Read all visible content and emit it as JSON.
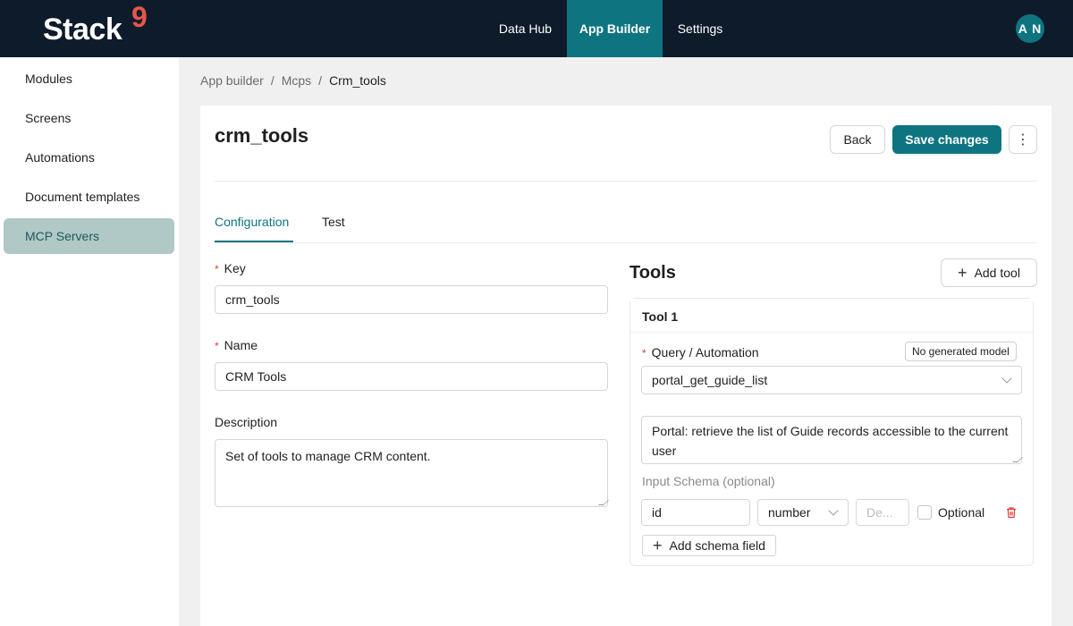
{
  "brand": {
    "logo_text": "Stack",
    "logo_mark": "9"
  },
  "nav": {
    "data_hub": "Data Hub",
    "app_builder": "App Builder",
    "settings": "Settings"
  },
  "user": {
    "initials": "A N"
  },
  "sidebar": {
    "items": [
      {
        "label": "Modules",
        "active": false
      },
      {
        "label": "Screens",
        "active": false
      },
      {
        "label": "Automations",
        "active": false
      },
      {
        "label": "Document templates",
        "active": false
      },
      {
        "label": "MCP Servers",
        "active": true
      }
    ]
  },
  "breadcrumb": {
    "root": "App builder",
    "sep": "/",
    "middle": "Mcps",
    "current": "Crm_tools"
  },
  "page": {
    "title": "crm_tools",
    "back_label": "Back",
    "save_label": "Save changes",
    "more_icon": "more-vertical-icon",
    "more_glyph": "⋮"
  },
  "tabs": {
    "configuration": "Configuration",
    "test": "Test",
    "active": "configuration"
  },
  "form": {
    "key_label": "Key",
    "key_value": "crm_tools",
    "name_label": "Name",
    "name_value": "CRM Tools",
    "description_label": "Description",
    "description_value": "Set of tools to manage CRM content.",
    "required_mark": "*"
  },
  "tools": {
    "title": "Tools",
    "add_tool_label": "Add tool",
    "add_glyph": "+",
    "items": [
      {
        "title": "Tool 1",
        "query_label": "Query / Automation",
        "badge": "No generated model",
        "query_value": "portal_get_guide_list",
        "description": "Portal: retrieve the list of Guide records accessible to the current user",
        "input_schema_label": "Input Schema (optional)",
        "fields": [
          {
            "name": "id",
            "type": "number",
            "description_placeholder": "De...",
            "optional_label": "Optional",
            "optional": false
          }
        ],
        "add_schema_field_label": "Add schema field"
      }
    ]
  },
  "colors": {
    "brand_teal": "#0e7580",
    "topbar": "#0d1b2a",
    "logo_accent": "#e8564b",
    "sidebar_active": "#b0c8c6",
    "required": "#e03a3a",
    "delete": "#e03a3a"
  }
}
